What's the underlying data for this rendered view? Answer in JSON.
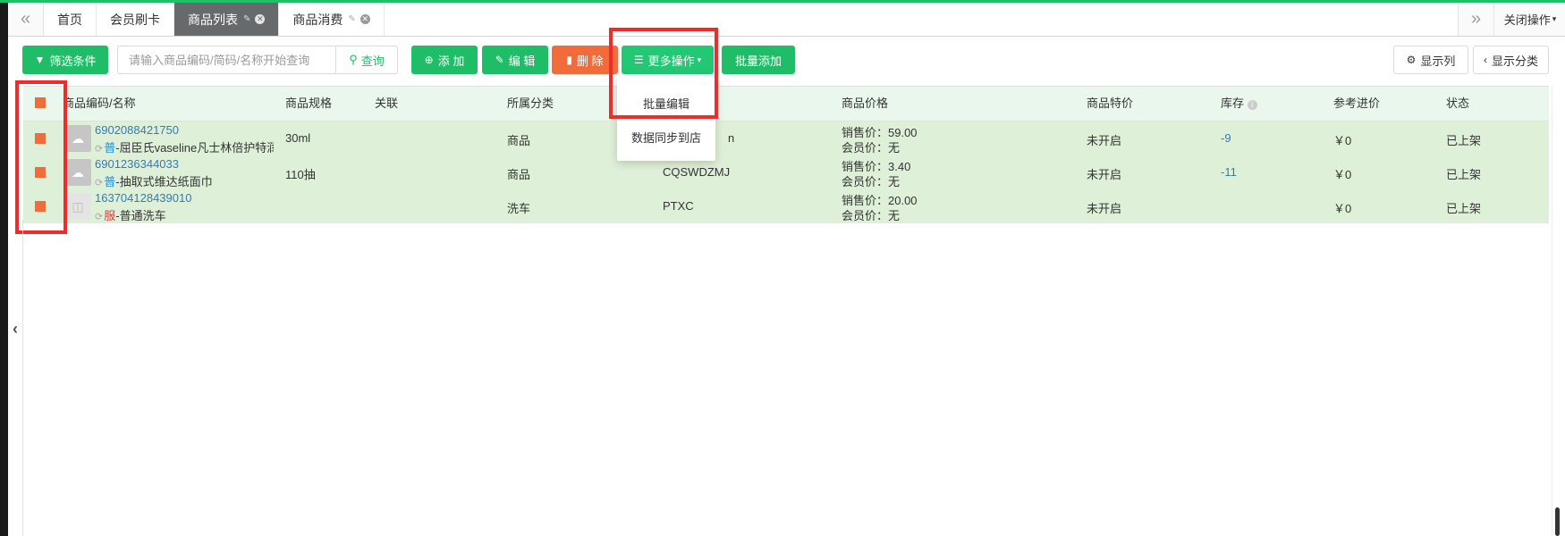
{
  "tabbar": {
    "tabs": [
      {
        "label": "首页",
        "active": false,
        "closable": false
      },
      {
        "label": "会员刷卡",
        "active": false,
        "closable": false
      },
      {
        "label": "商品列表",
        "active": true,
        "closable": true
      },
      {
        "label": "商品消费",
        "active": false,
        "closable": true
      }
    ],
    "close_ops_label": "关闭操作"
  },
  "toolbar": {
    "filter_label": "筛选条件",
    "search_placeholder": "请输入商品编码/简码/名称开始查询",
    "search_value": "",
    "search_label": "查询",
    "add_label": "添 加",
    "edit_label": "编 辑",
    "delete_label": "删 除",
    "more_label": "更多操作",
    "batch_add_label": "批量添加",
    "show_columns_label": "显示列",
    "show_category_label": "显示分类"
  },
  "dropdown": {
    "items": [
      "批量编辑",
      "数据同步到店"
    ]
  },
  "table": {
    "headers": {
      "code_name": "商品编码/名称",
      "spec": "商品规格",
      "link": "关联",
      "category": "所属分类",
      "price": "商品价格",
      "special": "商品特价",
      "stock": "库存",
      "cost": "参考进价",
      "status": "状态"
    },
    "rows": [
      {
        "code": "6902088421750",
        "type_tag": "普",
        "name": "-屈臣氏vaseline凡士林倍护特润",
        "spec": "30ml",
        "link": "",
        "category": "商品",
        "short_code": "n",
        "sale_price": "销售价：59.00",
        "member_price": "会员价：无",
        "special": "未开启",
        "stock": "-9",
        "cost": "￥0",
        "status": "已上架",
        "selected": true
      },
      {
        "code": "6901236344033",
        "type_tag": "普",
        "name": "-抽取式维达纸面巾",
        "spec": "110抽",
        "link": "",
        "category": "商品",
        "short_code": "CQSWDZMJ",
        "sale_price": "销售价：3.40",
        "member_price": "会员价：无",
        "special": "未开启",
        "stock": "-11",
        "cost": "￥0",
        "status": "已上架",
        "selected": true
      },
      {
        "code": "163704128439010",
        "type_tag": "服",
        "name": "-普通洗车",
        "spec": "",
        "link": "",
        "category": "洗车",
        "short_code": "PTXC",
        "sale_price": "销售价：20.00",
        "member_price": "会员价：无",
        "special": "未开启",
        "stock": "",
        "cost": "￥0",
        "status": "已上架",
        "selected": true
      }
    ]
  },
  "colors": {
    "accent_green": "#1fbd68",
    "danger_orange": "#f26b3a",
    "row_selected": "#dff0d8",
    "annotation_red": "#ef2b2b"
  }
}
